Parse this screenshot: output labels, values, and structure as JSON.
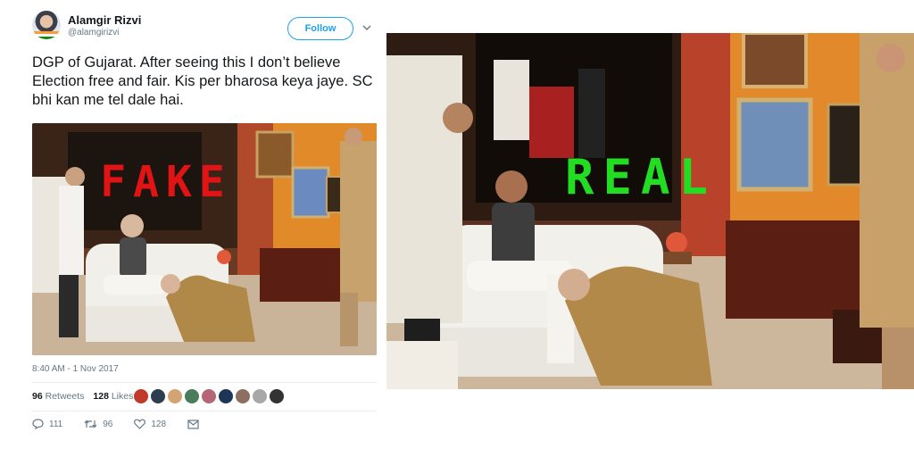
{
  "tweet": {
    "user_name": "Alamgir Rizvi",
    "user_handle": "@alamgirizvi",
    "follow_label": "Follow",
    "text": "DGP of Gujarat. After seeing this I don’t believe Election free and fair. Kis per bharosa keya jaye. SC bhi kan me tel dale hai.",
    "photo_overlay_label": "FAKE",
    "timestamp": "8:40 AM - 1 Nov 2017",
    "retweets_count": "96",
    "retweets_label": "Retweets",
    "likes_count": "128",
    "likes_label": "Likes",
    "reply_count": "111",
    "retweet_action_count": "96",
    "like_action_count": "128",
    "liker_avatar_colors": [
      "#c0392b",
      "#2c3e50",
      "#d4a373",
      "#4a7c59",
      "#b56576",
      "#1d3557",
      "#8d6e63",
      "#a8a8a8",
      "#333333"
    ]
  },
  "real_photo": {
    "overlay_label": "REAL"
  },
  "colors": {
    "fake_label": "#e01414",
    "real_label": "#22dd22",
    "twitter_blue": "#1da1f2",
    "muted_text": "#657786"
  }
}
